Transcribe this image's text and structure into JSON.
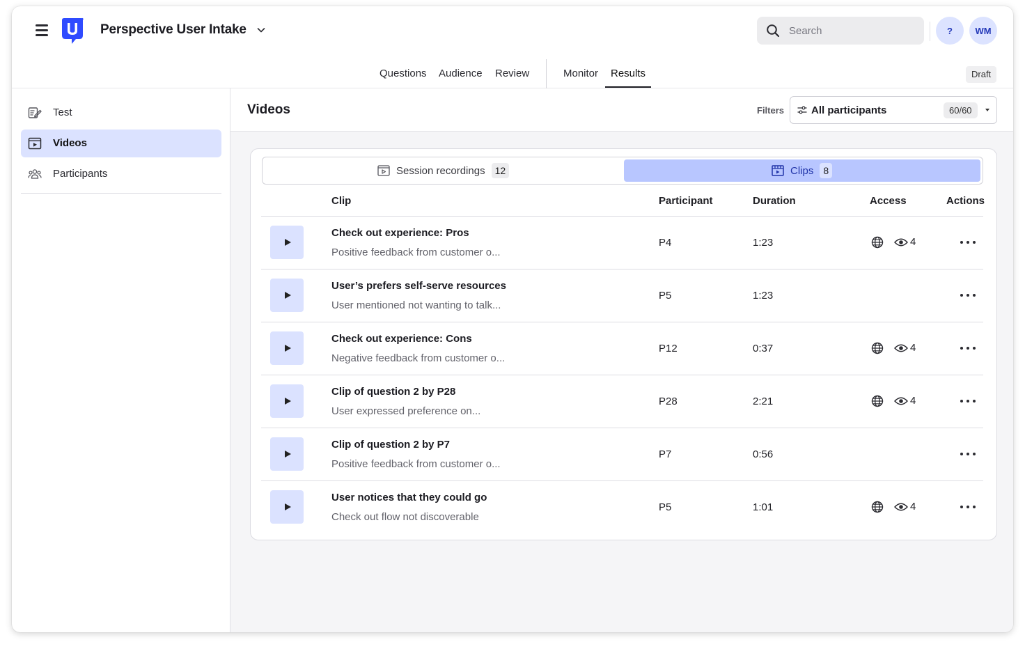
{
  "header": {
    "app_title": "Perspective User Intake",
    "search_placeholder": "Search",
    "help_label": "?",
    "avatar_initials": "WM",
    "status_badge": "Draft",
    "nav_tabs": [
      "Questions",
      "Audience",
      "Review",
      "Monitor",
      "Results"
    ],
    "active_tab": "Results",
    "brand_color": "#2f4bff"
  },
  "sidebar": {
    "items": [
      {
        "label": "Test",
        "icon": "test-edit-icon"
      },
      {
        "label": "Videos",
        "icon": "video-icon",
        "active": true
      },
      {
        "label": "Participants",
        "icon": "participants-icon"
      }
    ]
  },
  "main": {
    "title": "Videos",
    "filters_label": "Filters",
    "filter_value": "All participants",
    "filter_count": "60/60",
    "segments": [
      {
        "label": "Session recordings",
        "count": "12",
        "icon": "session-video-icon"
      },
      {
        "label": "Clips",
        "count": "8",
        "icon": "clip-film-icon",
        "active": true
      }
    ],
    "columns": [
      "Clip",
      "Participant",
      "Duration",
      "Access",
      "Actions"
    ],
    "rows": [
      {
        "title": "Check out experience: Pros",
        "desc": "Positive feedback from customer o...",
        "participant": "P4",
        "duration": "1:23",
        "access": true,
        "views": "4"
      },
      {
        "title": "User’s prefers self-serve resources",
        "desc": "User mentioned not wanting to talk...",
        "participant": "P5",
        "duration": "1:23",
        "access": false,
        "views": ""
      },
      {
        "title": "Check out experience: Cons",
        "desc": "Negative feedback from customer o...",
        "participant": "P12",
        "duration": "0:37",
        "access": true,
        "views": "4"
      },
      {
        "title": "Clip of question 2 by P28",
        "desc": "User expressed preference on...",
        "participant": "P28",
        "duration": "2:21",
        "access": true,
        "views": "4"
      },
      {
        "title": "Clip of question 2 by P7",
        "desc": "Positive feedback from customer o...",
        "participant": "P7",
        "duration": "0:56",
        "access": false,
        "views": ""
      },
      {
        "title": "User notices that they could go",
        "desc": "Check out flow not discoverable",
        "participant": "P5",
        "duration": "1:01",
        "access": true,
        "views": "4"
      }
    ]
  }
}
